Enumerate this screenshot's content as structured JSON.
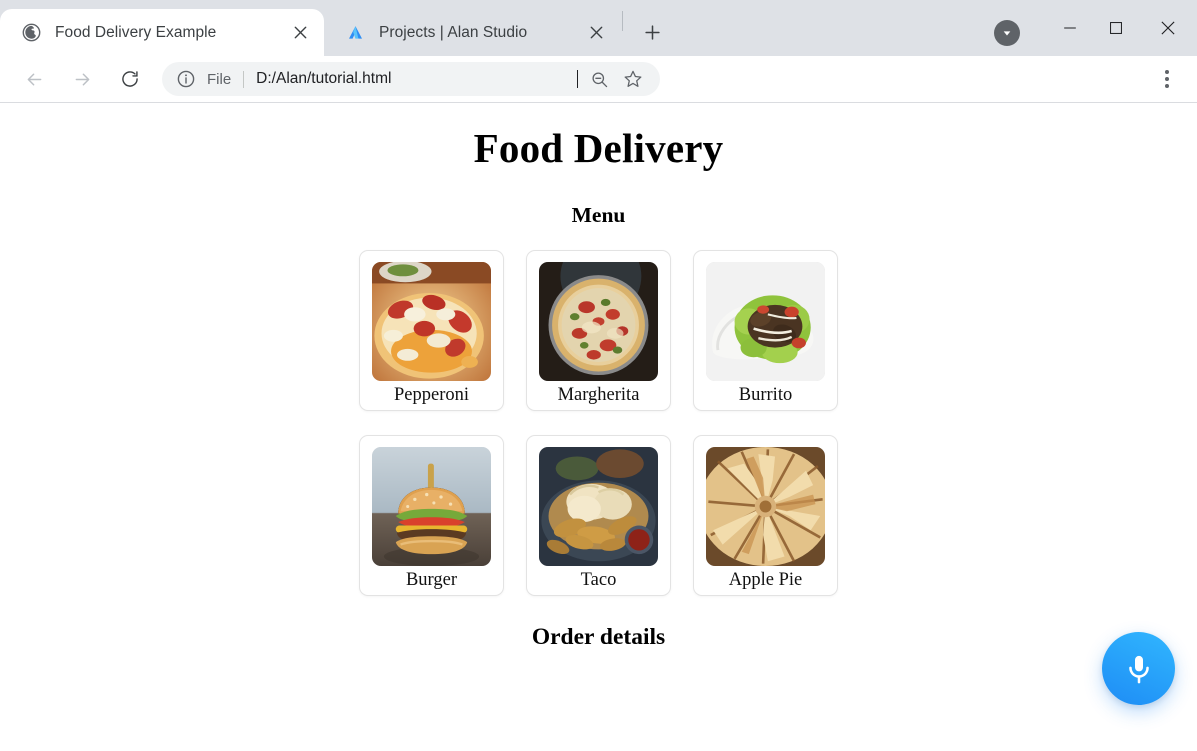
{
  "browser": {
    "tabs": [
      {
        "title": "Food Delivery Example",
        "favicon": "globe-icon",
        "active": true,
        "close_label": "×"
      },
      {
        "title": "Projects | Alan Studio",
        "favicon": "alan-logo-icon",
        "active": false,
        "close_label": "×"
      }
    ],
    "new_tab_label": "+",
    "window_controls": {
      "download_badge": "download-icon",
      "minimize": "−",
      "maximize": "□",
      "close": "×"
    },
    "toolbar": {
      "back": "back-arrow-icon",
      "forward": "forward-arrow-icon",
      "reload": "reload-icon",
      "site_info": "info-circle-icon",
      "scheme_label": "File",
      "url": "D:/Alan/tutorial.html",
      "zoom_out": "zoom-out-icon",
      "bookmark": "star-icon",
      "menu": "kebab-menu-icon"
    }
  },
  "page": {
    "title": "Food Delivery",
    "menu_heading": "Menu",
    "order_heading": "Order details",
    "menu_items": [
      {
        "label": "Pepperoni",
        "image": "pepperoni-pizza-photo"
      },
      {
        "label": "Margherita",
        "image": "margherita-pizza-photo"
      },
      {
        "label": "Burrito",
        "image": "burrito-photo"
      },
      {
        "label": "Burger",
        "image": "burger-photo"
      },
      {
        "label": "Taco",
        "image": "taco-photo"
      },
      {
        "label": "Apple Pie",
        "image": "apple-pie-photo"
      }
    ],
    "voice_button": {
      "icon": "microphone-icon",
      "color": "#2aa8fb"
    }
  }
}
